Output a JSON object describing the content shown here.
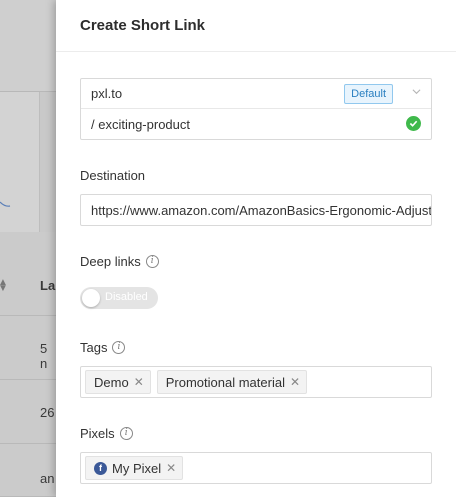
{
  "background": {
    "column_header": "La",
    "cells": [
      "5 n",
      "26",
      "an"
    ]
  },
  "drawer": {
    "title": "Create Short Link",
    "domain": {
      "value": "pxl.to",
      "badge": "Default",
      "slug": "/ exciting-product"
    },
    "destination": {
      "label": "Destination",
      "value": "https://www.amazon.com/AmazonBasics-Ergonomic-Adjustable-Mouse"
    },
    "deep_links": {
      "label": "Deep links",
      "toggle_text": "Disabled"
    },
    "tags": {
      "label": "Tags",
      "items": [
        "Demo",
        "Promotional material"
      ]
    },
    "pixels": {
      "label": "Pixels",
      "items": [
        "My Pixel"
      ]
    }
  },
  "colors": {
    "accent_blue": "#2a7fc0",
    "success_green": "#3fb94b",
    "facebook_blue": "#3b5998"
  }
}
